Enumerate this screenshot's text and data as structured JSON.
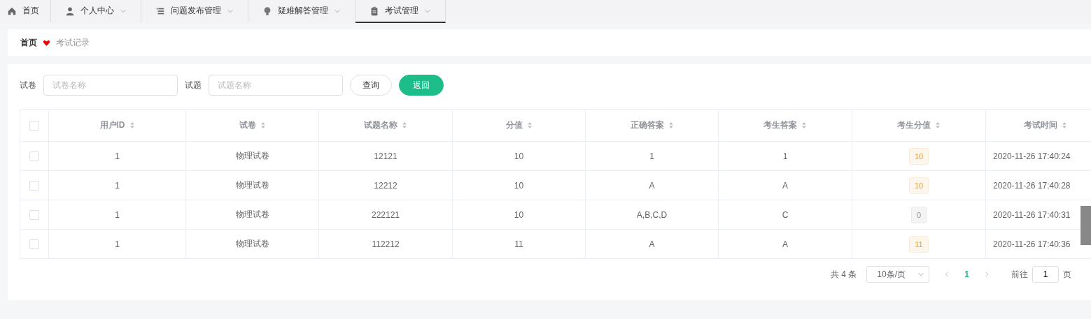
{
  "nav": [
    {
      "label": "首页",
      "dropdown": false,
      "selected": false
    },
    {
      "label": "个人中心",
      "dropdown": true,
      "selected": false
    },
    {
      "label": "问题发布管理",
      "dropdown": true,
      "selected": false
    },
    {
      "label": "疑难解答管理",
      "dropdown": true,
      "selected": false
    },
    {
      "label": "考试管理",
      "dropdown": true,
      "selected": true
    }
  ],
  "breadcrumb": [
    "首页",
    "考试记录"
  ],
  "search": [
    {
      "label": "试卷",
      "placeholder": "试卷名称"
    },
    {
      "label": "试题",
      "placeholder": "试题名称"
    }
  ],
  "buttons": [
    {
      "label": "查询",
      "kind": "plain"
    },
    {
      "label": "返回",
      "kind": "primary"
    }
  ],
  "table": {
    "select_all_checked": false,
    "columns": [
      "用户ID",
      "试卷",
      "试题名称",
      "分值",
      "正确答案",
      "考生答案",
      "考生分值",
      "考试时间"
    ],
    "rows": [
      {
        "checked": false,
        "cells": [
          "1",
          "物理试卷",
          "12121",
          "10",
          "1",
          "1"
        ],
        "score": {
          "text": "10",
          "kind": "warning"
        },
        "time": "2020-11-26 17:40:24"
      },
      {
        "checked": false,
        "cells": [
          "1",
          "物理试卷",
          "12212",
          "10",
          "A",
          "A"
        ],
        "score": {
          "text": "10",
          "kind": "warning"
        },
        "time": "2020-11-26 17:40:28"
      },
      {
        "checked": false,
        "cells": [
          "1",
          "物理试卷",
          "222121",
          "10",
          "A,B,C,D",
          "C"
        ],
        "score": {
          "text": "0",
          "kind": "info"
        },
        "time": "2020-11-26 17:40:31"
      },
      {
        "checked": false,
        "cells": [
          "1",
          "物理试卷",
          "112212",
          "11",
          "A",
          "A"
        ],
        "score": {
          "text": "11",
          "kind": "warning"
        },
        "time": "2020-11-26 17:40:36"
      }
    ]
  },
  "pagination": {
    "total": "共 4 条",
    "page_size": "10条/页",
    "pages": [
      {
        "label": "1",
        "selected": true
      }
    ],
    "goto_label": "前往",
    "goto_value": "1",
    "page_unit": "页"
  }
}
